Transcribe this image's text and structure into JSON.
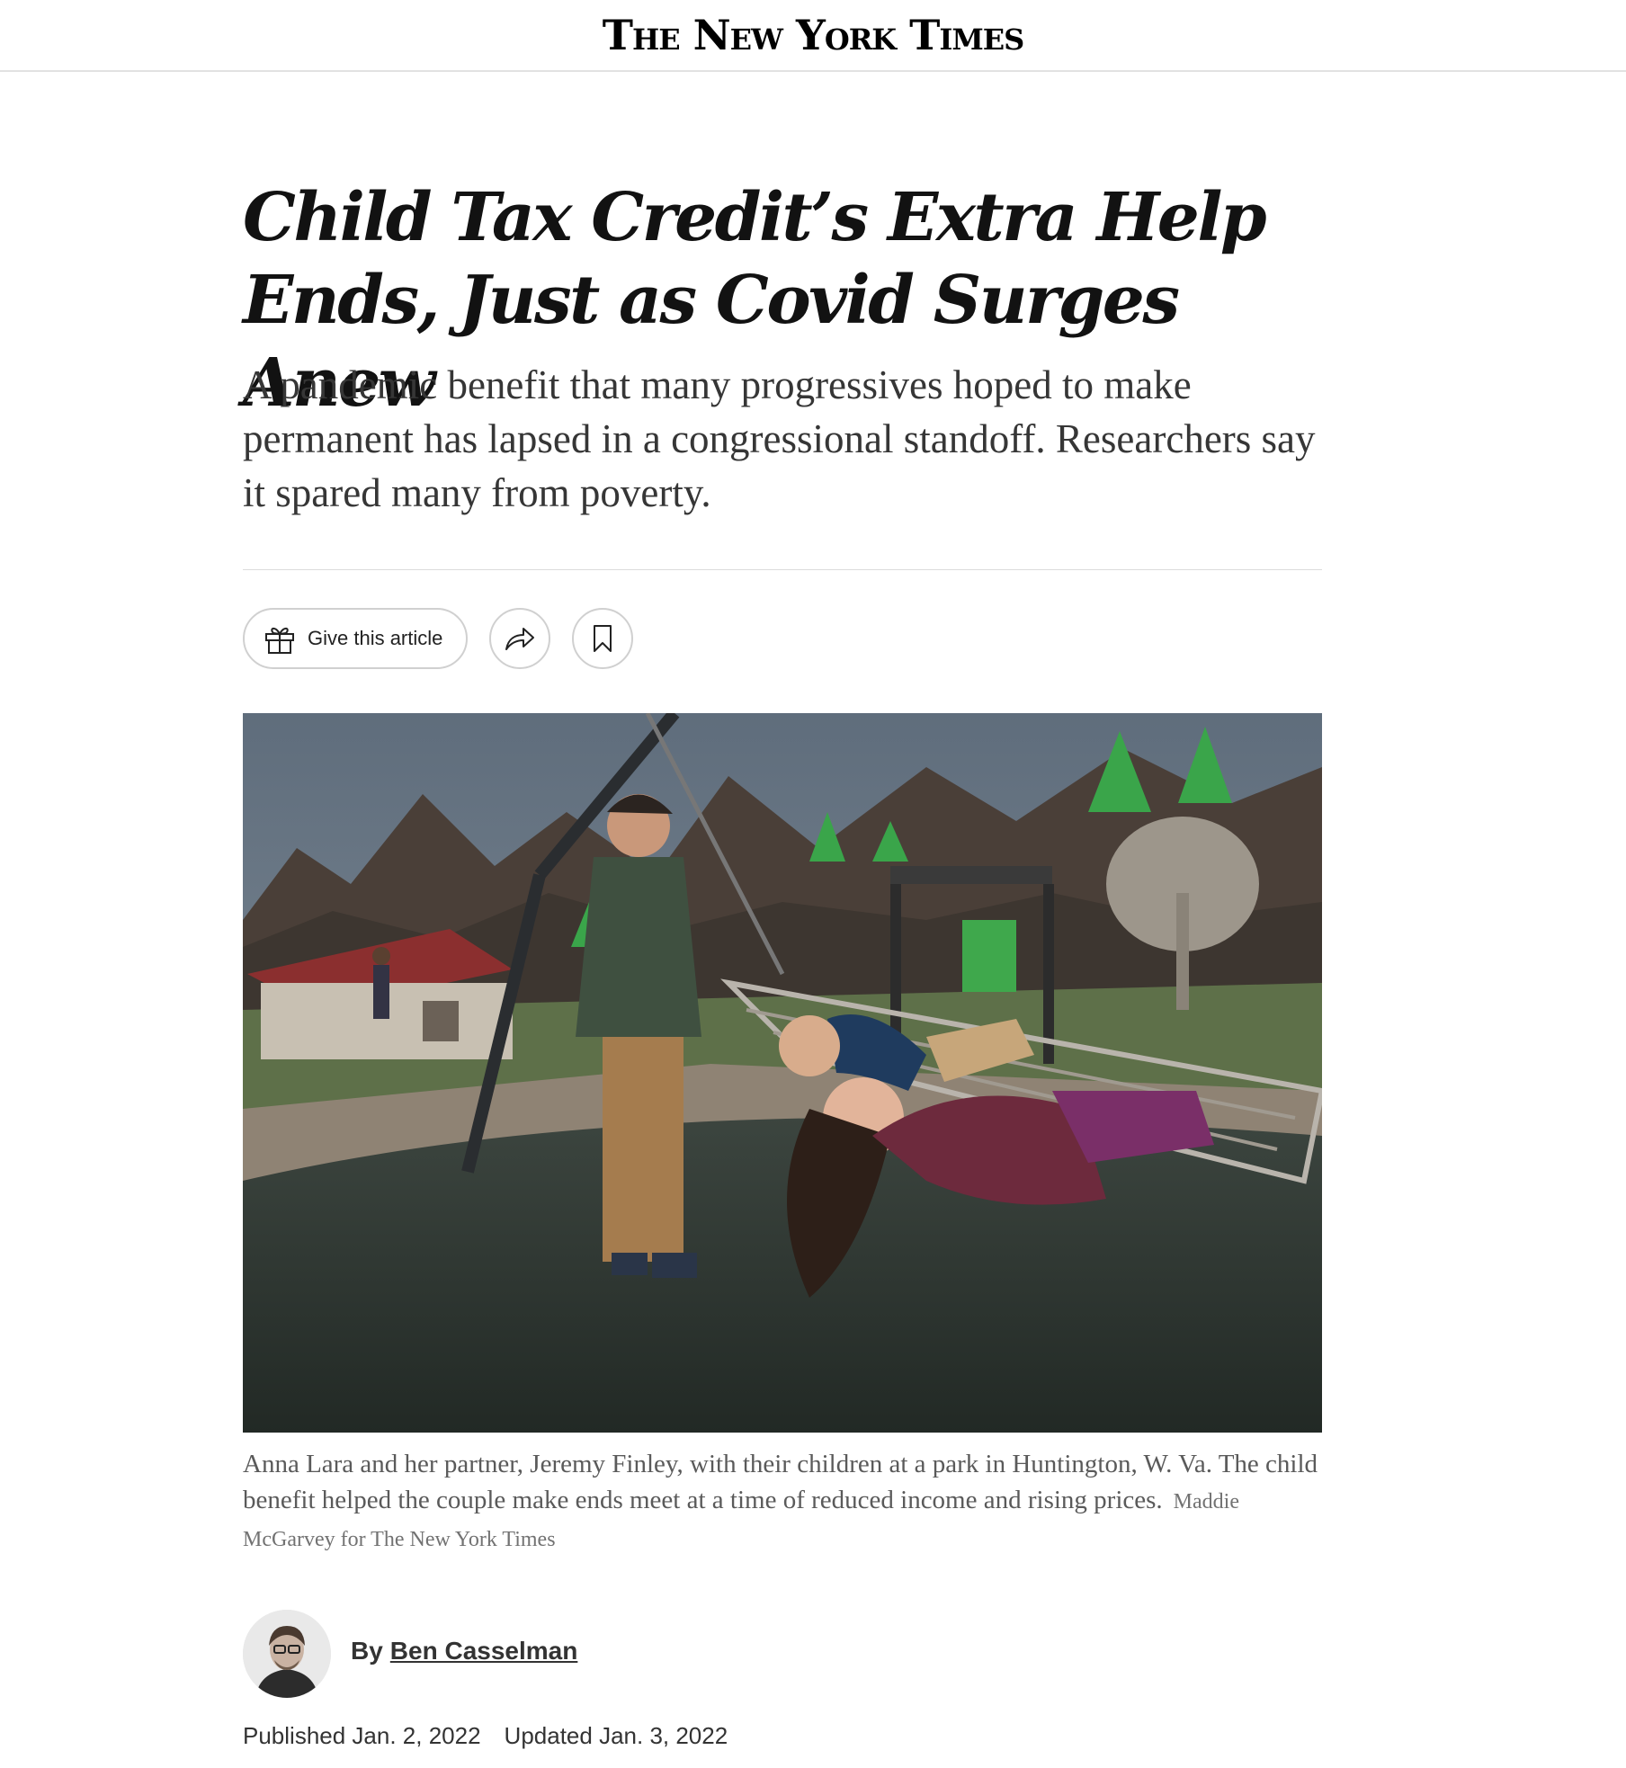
{
  "masthead": {
    "logo_text": "The New York Times"
  },
  "article": {
    "headline": "Child Tax Credit’s Extra Help Ends, Just as Covid Surges Anew",
    "summary": "A pandemic benefit that many progressives hoped to make permanent has lapsed in a congressional standoff. Researchers say it spared many from poverty.",
    "actions": {
      "gift_label": "Give this article",
      "share_icon": "share-icon",
      "save_icon": "bookmark-icon"
    },
    "photo": {
      "caption": "Anna Lara and her partner, Jeremy Finley, with their children at a park in Huntington, W. Va. The child benefit helped the couple make ends meet at a time of reduced income and rising prices.",
      "credit": "Maddie McGarvey for The New York Times"
    },
    "byline": {
      "prefix": "By",
      "author": "Ben Casselman"
    },
    "dates": {
      "published": "Published Jan. 2, 2022",
      "updated": "Updated Jan. 3, 2022"
    }
  },
  "colors": {
    "text": "#121212",
    "summary_text": "#363636",
    "caption_text": "#5a5a5a",
    "divider": "#dcdcdc"
  }
}
